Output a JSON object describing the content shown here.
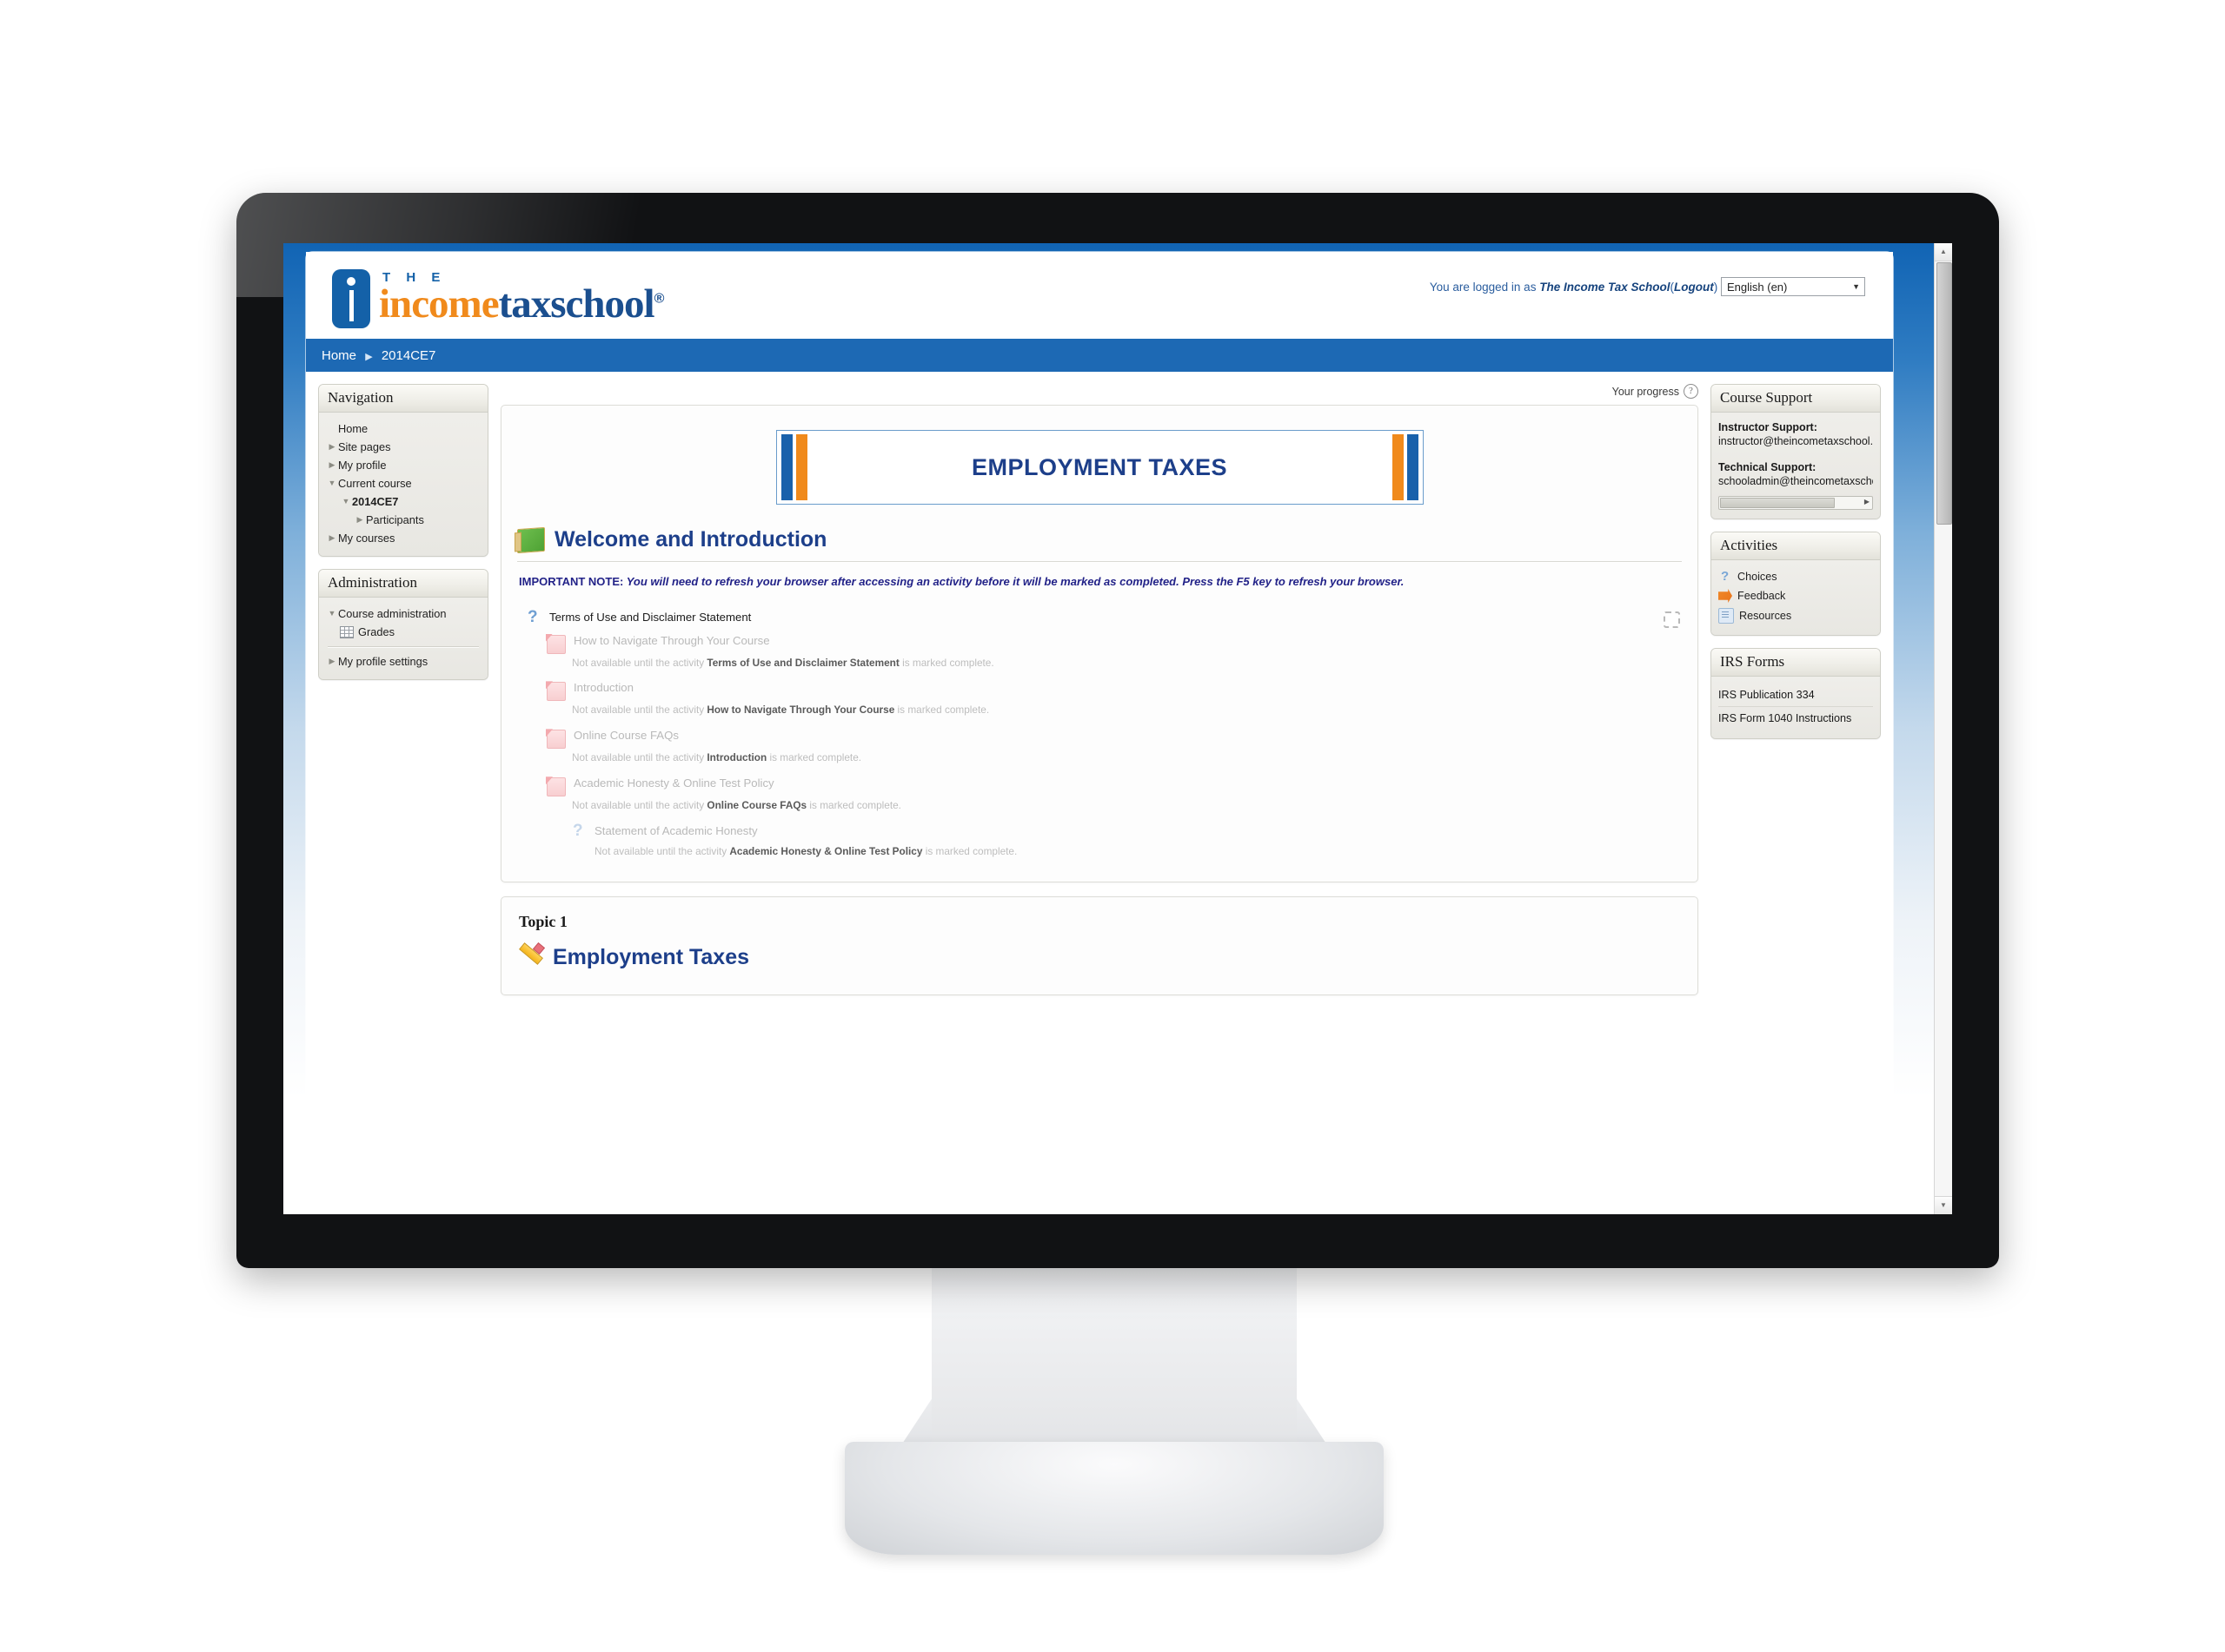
{
  "header": {
    "logo": {
      "the": "T H E",
      "income": "income",
      "tax": "tax",
      "school": "school",
      "registered": "®"
    },
    "login_prefix": "You are logged in as",
    "user_name": "The Income Tax School",
    "logout_open": "(",
    "logout_label": "Logout",
    "logout_close": ")",
    "language_value": "English (en)",
    "language_arrow": "▼"
  },
  "breadcrumb": {
    "home": "Home",
    "separator": "▶",
    "course": "2014CE7"
  },
  "navigation_block": {
    "title": "Navigation",
    "items": [
      {
        "label": "Home",
        "arrow": "none",
        "indent": 1,
        "bold": false
      },
      {
        "label": "Site pages",
        "arrow": "closed",
        "indent": 1,
        "bold": false
      },
      {
        "label": "My profile",
        "arrow": "closed",
        "indent": 1,
        "bold": false
      },
      {
        "label": "Current course",
        "arrow": "open",
        "indent": 1,
        "bold": false
      },
      {
        "label": "2014CE7",
        "arrow": "open",
        "indent": 2,
        "bold": true
      },
      {
        "label": "Participants",
        "arrow": "closed",
        "indent": 3,
        "bold": false
      },
      {
        "label": "My courses",
        "arrow": "closed",
        "indent": 1,
        "bold": false
      }
    ]
  },
  "administration_block": {
    "title": "Administration",
    "course_admin": "Course administration",
    "grades": "Grades",
    "my_profile_settings": "My profile settings"
  },
  "course_support_block": {
    "title": "Course Support",
    "instructor_label": "Instructor Support:",
    "instructor_email": "instructor@theincometaxschool.com",
    "technical_label": "Technical Support:",
    "technical_email": "schooladmin@theincometaxschool.com"
  },
  "activities_block": {
    "title": "Activities",
    "items": [
      {
        "label": "Choices",
        "icon": "choice-icon"
      },
      {
        "label": "Feedback",
        "icon": "feedback-icon"
      },
      {
        "label": "Resources",
        "icon": "resource-icon"
      }
    ]
  },
  "irs_forms_block": {
    "title": "IRS Forms",
    "items": [
      {
        "label": "IRS Publication 334"
      },
      {
        "label": "IRS Form 1040 Instructions"
      }
    ]
  },
  "main": {
    "progress_label": "Your progress",
    "progress_help": "?",
    "course_banner_title": "EMPLOYMENT TAXES",
    "welcome_heading": "Welcome and Introduction",
    "important_note_label": "IMPORTANT NOTE:",
    "important_note_body": " You will need to refresh your browser after accessing an activity before it will be marked as completed.  Press the F5 key to refresh your browser.",
    "activities": [
      {
        "name": "Terms of Use and Disclaimer Statement",
        "icon": "choice-icon",
        "dim": false,
        "nesting": 0,
        "has_completion_box": true,
        "restriction_prefix": "",
        "restriction_bold": "",
        "restriction_suffix": ""
      },
      {
        "name": "How to Navigate Through Your Course",
        "icon": "feedback-icon",
        "dim": true,
        "nesting": 1,
        "has_completion_box": false,
        "restriction_prefix": "Not available until the activity ",
        "restriction_bold": "Terms of Use and Disclaimer Statement",
        "restriction_suffix": " is marked complete."
      },
      {
        "name": "Introduction",
        "icon": "feedback-icon",
        "dim": true,
        "nesting": 1,
        "has_completion_box": false,
        "restriction_prefix": "Not available until the activity ",
        "restriction_bold": "How to Navigate Through Your Course",
        "restriction_suffix": " is marked complete."
      },
      {
        "name": "Online Course FAQs",
        "icon": "feedback-icon",
        "dim": true,
        "nesting": 1,
        "has_completion_box": false,
        "restriction_prefix": "Not available until the activity ",
        "restriction_bold": "Introduction",
        "restriction_suffix": " is marked complete."
      },
      {
        "name": "Academic Honesty & Online Test Policy",
        "icon": "feedback-icon",
        "dim": true,
        "nesting": 1,
        "has_completion_box": false,
        "restriction_prefix": "Not available until the activity ",
        "restriction_bold": "Online Course FAQs",
        "restriction_suffix": " is marked complete."
      },
      {
        "name": "Statement of Academic Honesty",
        "icon": "choice-icon",
        "dim": true,
        "nesting": 2,
        "has_completion_box": false,
        "restriction_prefix": "Not available until the activity ",
        "restriction_bold": "Academic Honesty & Online Test Policy",
        "restriction_suffix": " is marked complete."
      }
    ],
    "topic_label": "Topic 1",
    "topic_heading": "Employment Taxes"
  },
  "colors": {
    "brand_blue": "#1461a8",
    "brand_orange": "#f08a1c",
    "navbar_blue": "#1d69b4",
    "heading_blue": "#1d3f8a",
    "note_blue": "#222288"
  },
  "scrollbar": {
    "up_arrow": "▲",
    "down_arrow": "▼"
  }
}
